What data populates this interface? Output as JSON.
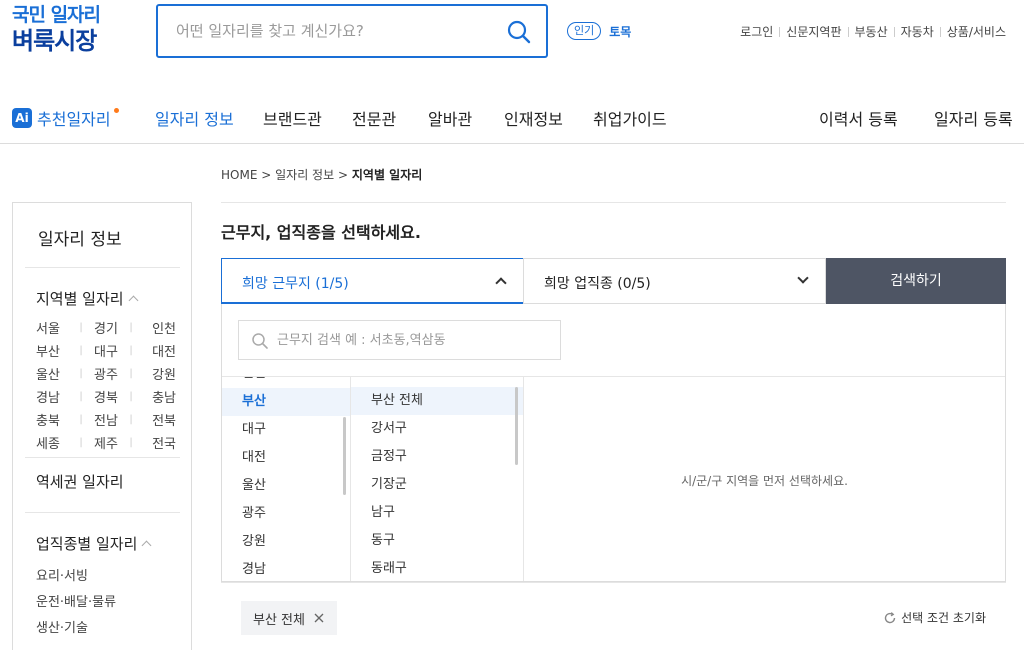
{
  "logo": {
    "line1": "국민 일자리",
    "line2": "벼룩시장"
  },
  "search": {
    "placeholder": "어떤 일자리를 찾고 계신가요?",
    "value": ""
  },
  "popular": {
    "badge": "인기",
    "keyword": "토목"
  },
  "util_links": [
    "로그인",
    "신문지역판",
    "부동산",
    "자동차",
    "상품/서비스"
  ],
  "nav": {
    "ai_badge": "Ai",
    "ai_label": "추천일자리",
    "items": [
      "일자리 정보",
      "브랜드관",
      "전문관",
      "알바관",
      "인재정보",
      "취업가이드"
    ],
    "right_items": [
      "이력서 등록",
      "일자리 등록"
    ]
  },
  "breadcrumb": {
    "home": "HOME",
    "sep": ">",
    "level1": "일자리 정보",
    "current": "지역별 일자리"
  },
  "sidebar": {
    "title": "일자리 정보",
    "region_heading": "지역별 일자리",
    "regions": [
      [
        "서울",
        "경기",
        "인천"
      ],
      [
        "부산",
        "대구",
        "대전"
      ],
      [
        "울산",
        "광주",
        "강원"
      ],
      [
        "경남",
        "경북",
        "충남"
      ],
      [
        "충북",
        "전남",
        "전북"
      ],
      [
        "세종",
        "제주",
        "전국"
      ]
    ],
    "station_heading": "역세권 일자리",
    "occupation_heading": "업직종별 일자리",
    "occupations": [
      "요리·서빙",
      "운전·배달·물류",
      "생산·기술"
    ]
  },
  "content": {
    "title": "근무지, 업직종을 선택하세요.",
    "area_filter": "희망 근무지 (1/5)",
    "job_filter": "희망 업직종 (0/5)",
    "search_button": "검색하기",
    "area_search_placeholder": "근무지 검색 예 : 서초동,역삼동",
    "provinces": [
      "인천",
      "부산",
      "대구",
      "대전",
      "울산",
      "광주",
      "강원",
      "경남"
    ],
    "selected_province": "부산",
    "districts": [
      "부산 전체",
      "강서구",
      "금정구",
      "기장군",
      "남구",
      "동구",
      "동래구"
    ],
    "selected_district": "부산 전체",
    "dong_hint": "시/군/구 지역을 먼저 선택하세요.",
    "chip_label": "부산 전체",
    "reset_label": "선택 조건 초기화"
  },
  "colors": {
    "brand_blue": "#1a6fd6",
    "navy": "#0b3f9e",
    "search_button_bg": "#4e5564",
    "accent_dot": "#ff7a1a"
  }
}
